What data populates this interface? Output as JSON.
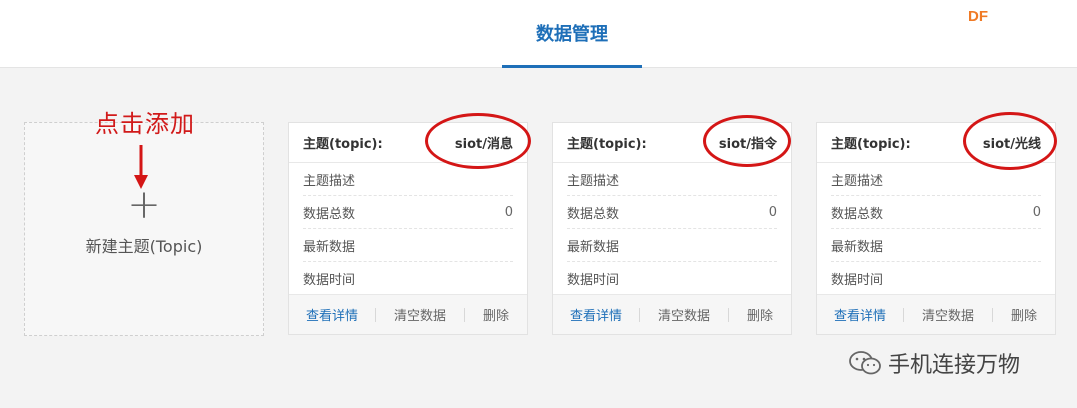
{
  "header": {
    "active_tab": "数据管理",
    "watermark": "DF"
  },
  "new_topic": {
    "plus": "+",
    "label": "新建主题(Topic)",
    "annotation": "点击添加"
  },
  "cards": [
    {
      "topic_label": "主题(topic):",
      "topic_value": "siot/消息",
      "rows": [
        {
          "label": "主题描述",
          "value": ""
        },
        {
          "label": "数据总数",
          "value": "0"
        },
        {
          "label": "最新数据",
          "value": ""
        },
        {
          "label": "数据时间",
          "value": ""
        }
      ],
      "actions": {
        "view": "查看详情",
        "clear": "清空数据",
        "delete": "删除"
      }
    },
    {
      "topic_label": "主题(topic):",
      "topic_value": "siot/指令",
      "rows": [
        {
          "label": "主题描述",
          "value": ""
        },
        {
          "label": "数据总数",
          "value": "0"
        },
        {
          "label": "最新数据",
          "value": ""
        },
        {
          "label": "数据时间",
          "value": ""
        }
      ],
      "actions": {
        "view": "查看详情",
        "clear": "清空数据",
        "delete": "删除"
      }
    },
    {
      "topic_label": "主题(topic):",
      "topic_value": "siot/光线",
      "rows": [
        {
          "label": "主题描述",
          "value": ""
        },
        {
          "label": "数据总数",
          "value": "0"
        },
        {
          "label": "最新数据",
          "value": ""
        },
        {
          "label": "数据时间",
          "value": ""
        }
      ],
      "actions": {
        "view": "查看详情",
        "clear": "清空数据",
        "delete": "删除"
      }
    }
  ],
  "footer_watermark": "手机连接万物",
  "colors": {
    "accent": "#1e6fb8",
    "annotation_red": "#d41616",
    "watermark_orange": "#f07a25"
  }
}
